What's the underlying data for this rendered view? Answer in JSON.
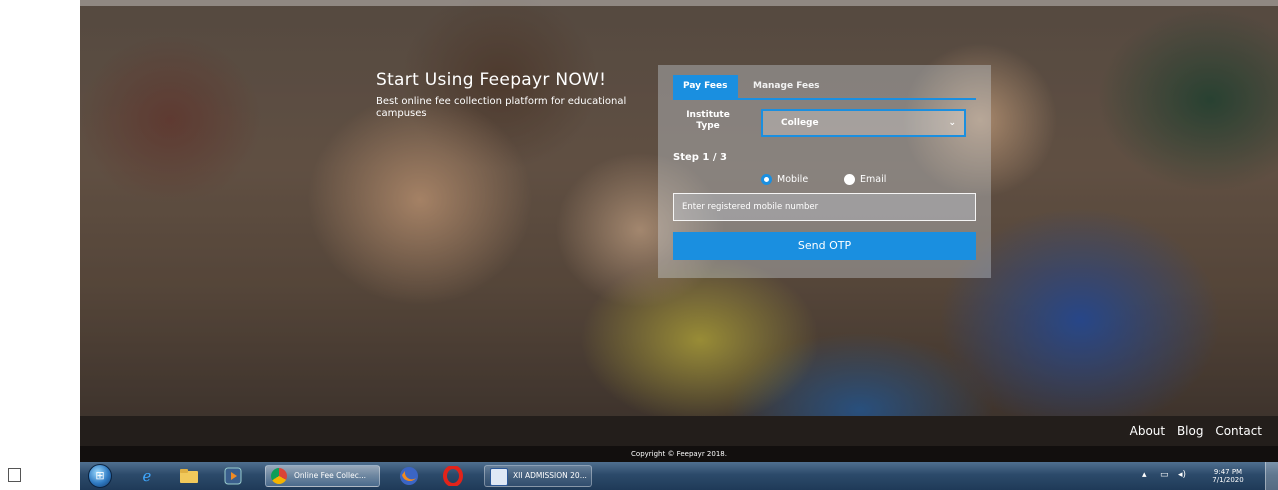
{
  "hero": {
    "title": "Start Using Feepayr NOW!",
    "subtitle": "Best online fee collection platform for educational campuses"
  },
  "form": {
    "tabs": [
      "Pay Fees",
      "Manage Fees"
    ],
    "institute_label": "Institute Type",
    "institute_value": "College",
    "step": "Step 1 / 3",
    "radio_mobile": "Mobile",
    "radio_email": "Email",
    "selected_contact": "Mobile",
    "mobile_placeholder": "Enter registered mobile number",
    "send_otp": "Send OTP",
    "accent_color": "#1a8fe0"
  },
  "footer": {
    "links": [
      "About",
      "Blog",
      "Contact"
    ],
    "copyright": "Copyright © Feepayr 2018."
  },
  "taskbar": {
    "tasks": [
      "Online Fee Collec...",
      "XII ADMISSION 20..."
    ],
    "icons": [
      "windows-start-icon",
      "internet-explorer-icon",
      "file-explorer-icon",
      "media-player-icon",
      "chrome-icon",
      "firefox-icon",
      "opera-icon",
      "word-document-icon"
    ],
    "clock_time": "9:47 PM",
    "clock_date": "7/1/2020"
  }
}
